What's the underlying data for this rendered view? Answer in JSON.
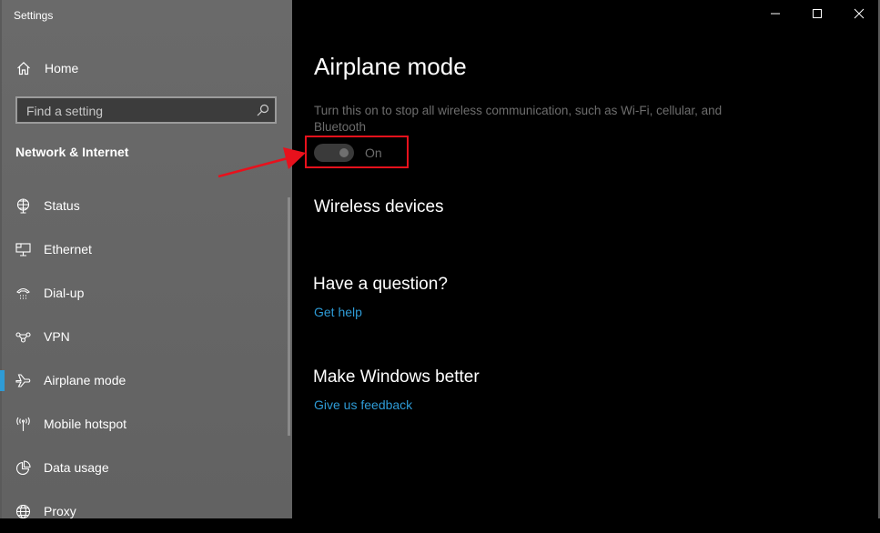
{
  "window": {
    "title": "Settings",
    "caption_buttons": [
      {
        "name": "minimize",
        "icon": "minimize-icon"
      },
      {
        "name": "maximize",
        "icon": "maximize-icon"
      },
      {
        "name": "close",
        "icon": "close-icon"
      }
    ]
  },
  "sidebar": {
    "home_label": "Home",
    "search": {
      "placeholder": "Find a setting",
      "value": ""
    },
    "section_title": "Network & Internet",
    "items": [
      {
        "label": "Status",
        "icon": "globe-status-icon",
        "active": false
      },
      {
        "label": "Ethernet",
        "icon": "ethernet-icon",
        "active": false
      },
      {
        "label": "Dial-up",
        "icon": "dial-up-icon",
        "active": false
      },
      {
        "label": "VPN",
        "icon": "vpn-icon",
        "active": false
      },
      {
        "label": "Airplane mode",
        "icon": "airplane-icon",
        "active": true
      },
      {
        "label": "Mobile hotspot",
        "icon": "hotspot-icon",
        "active": false
      },
      {
        "label": "Data usage",
        "icon": "data-usage-icon",
        "active": false
      },
      {
        "label": "Proxy",
        "icon": "globe-icon",
        "active": false
      }
    ]
  },
  "main": {
    "title": "Airplane mode",
    "description": "Turn this on to stop all wireless communication, such as Wi-Fi, cellular, and Bluetooth",
    "toggle": {
      "state": "On",
      "on": true,
      "disabled": true
    },
    "wireless_devices_heading": "Wireless devices",
    "help": {
      "heading": "Have a question?",
      "link": "Get help"
    },
    "feedback": {
      "heading": "Make Windows better",
      "link": "Give us feedback"
    }
  },
  "colors": {
    "accent": "#2e9bd6",
    "annotation": "#e8111c",
    "sidebar_bg": "#666666",
    "content_bg": "#000000"
  }
}
